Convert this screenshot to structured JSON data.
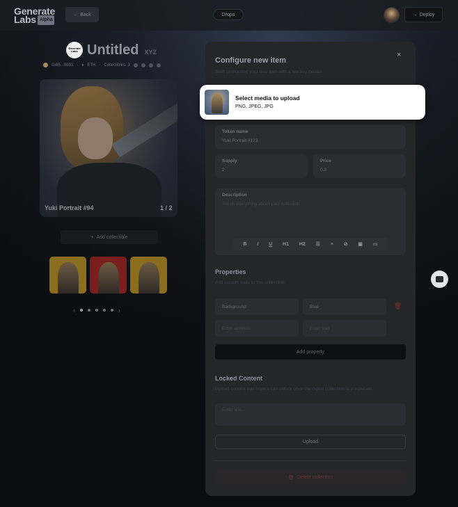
{
  "topbar": {
    "logo_line1": "Generate",
    "logo_line2": "Labs",
    "logo_badge": "Alpha",
    "back_label": "Back",
    "drops_label": "Drops",
    "deploy_label": "Deploy"
  },
  "collection": {
    "logo_text": "Generate Labs",
    "title": "Untitled",
    "suffix": "XYZ",
    "address": "0x85...0b33",
    "currency": "ETH",
    "collectibles_label": "Collectibles: 3",
    "card_label": "Yuki Portrait #94",
    "card_count": "1 / 2",
    "add_collectible": "Add collectible"
  },
  "modal": {
    "title": "Configure new item",
    "subtitle": "Start configuring your new item with a few key details",
    "close": "×",
    "media": {
      "title": "Select media to upload",
      "formats": "PNG, JPEG, JPG"
    },
    "token_name": {
      "label": "Token name",
      "value": "Yuki Portrait #123"
    },
    "supply": {
      "label": "Supply",
      "value": "2"
    },
    "price": {
      "label": "Price",
      "value": "0.3"
    },
    "description": {
      "label": "Description",
      "placeholder": "Tell us everything about your collection"
    },
    "toolbar": [
      "B",
      "I",
      "U",
      "H1",
      "H2",
      "☰",
      "≡",
      "⊘",
      "▣",
      "▭"
    ],
    "properties": {
      "title": "Properties",
      "subtitle": "Add custom traits to this collectible",
      "rows": [
        {
          "name": "Background",
          "value": "Blue"
        },
        {
          "name": "Enter attribute",
          "value": "Enter trait"
        }
      ],
      "add_label": "Add property"
    },
    "locked": {
      "title": "Locked Content",
      "subtitle": "Upload content that buyers can unlock once the digital collectible is purchased.",
      "placeholder": "Enter text...",
      "upload_label": "Upload"
    },
    "delete_label": "Delete collection"
  },
  "colors": {
    "accent_danger": "#7a3434",
    "modal_bg": "#252628"
  }
}
